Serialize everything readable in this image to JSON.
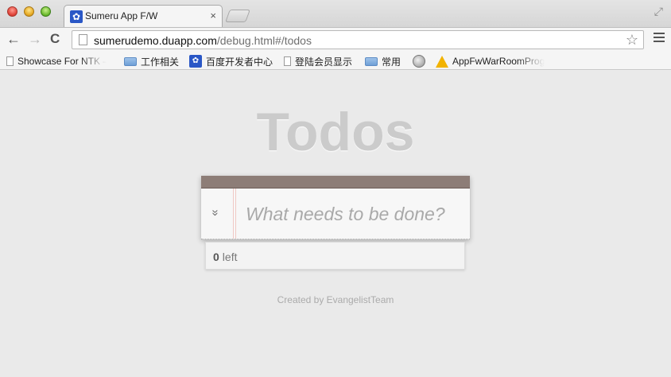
{
  "browser": {
    "tab_title": "Sumeru App F/W",
    "tab_close": "×",
    "url_host": "sumerudemo.duapp.com",
    "url_path": "/debug.html#/todos"
  },
  "toolbar": {
    "back": "←",
    "forward": "→",
    "reload": "C",
    "star": "☆",
    "fullscreen": "⤢"
  },
  "bookmarks": [
    {
      "label": "Showcase For NTK –",
      "icon": "page-icon"
    },
    {
      "label": "工作相关",
      "icon": "folder-icon"
    },
    {
      "label": "百度开发者中心",
      "icon": "paw-icon"
    },
    {
      "label": "登陆会员显示",
      "icon": "page-icon"
    },
    {
      "label": "常用",
      "icon": "folder-icon"
    },
    {
      "label": "",
      "icon": "globe-icon"
    },
    {
      "label": "AppFwWarRoomProg",
      "icon": "cone-icon"
    }
  ],
  "app": {
    "title": "Todos",
    "toggle_all": "»",
    "input_placeholder": "What needs to be done?",
    "input_value": "",
    "count": "0",
    "count_label": "left",
    "credits": "Created by EvangelistTeam"
  },
  "colors": {
    "header_bar": "#8d7d77",
    "title": "#cbcbcb",
    "background": "#eaeaea"
  }
}
